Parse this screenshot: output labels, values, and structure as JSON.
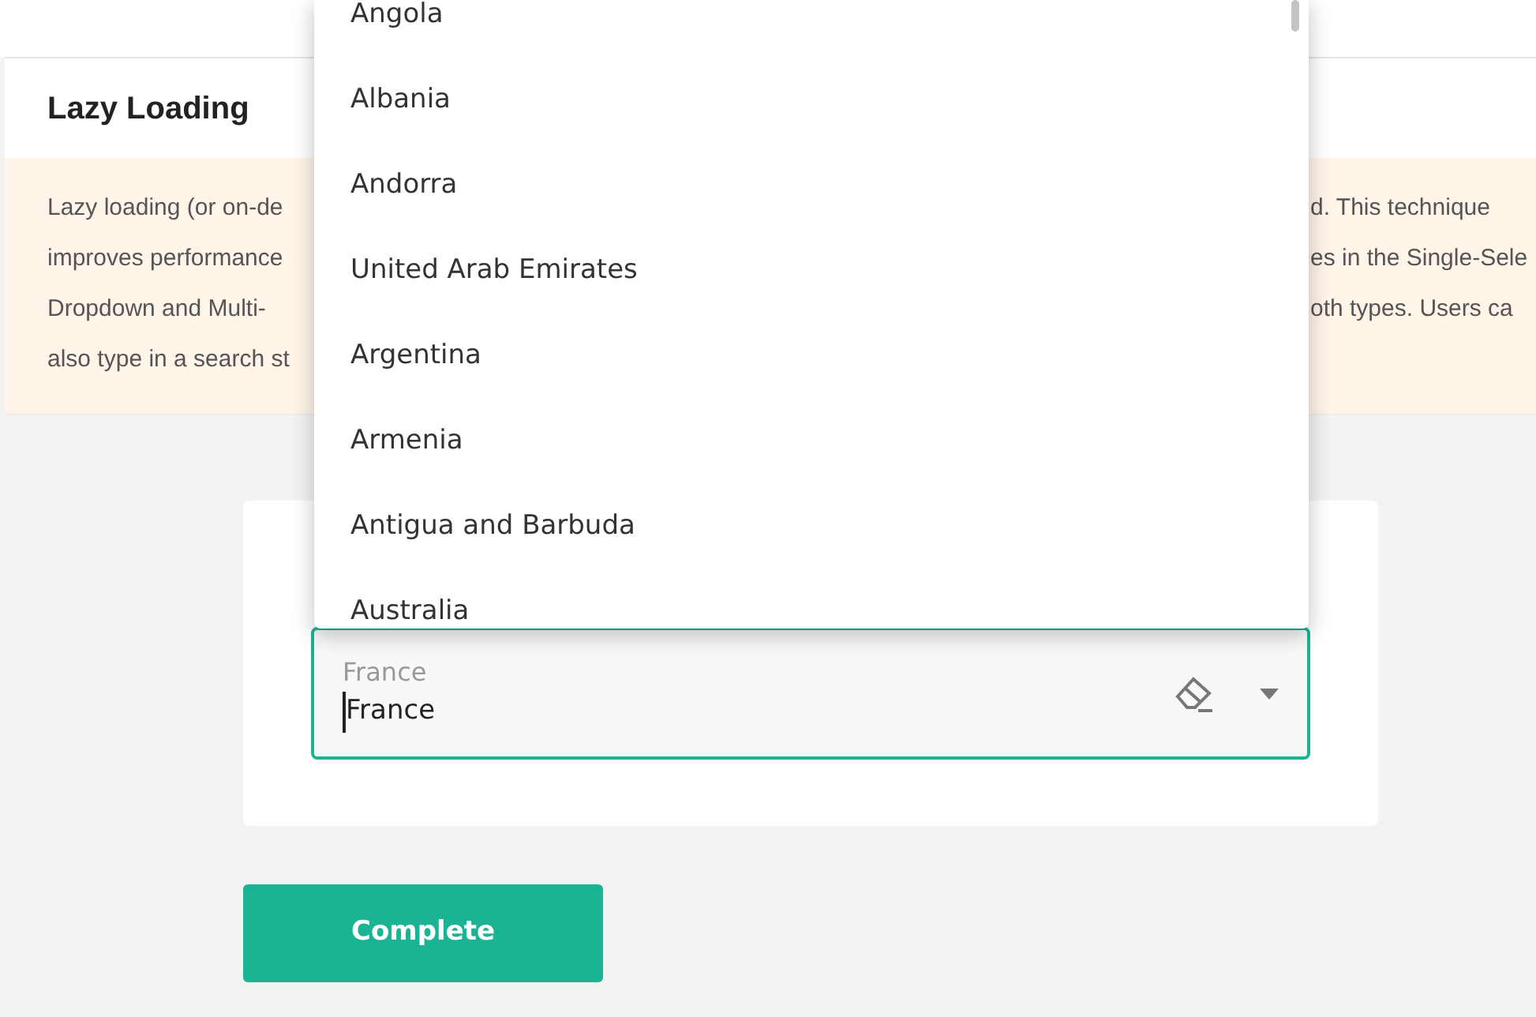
{
  "section": {
    "title": "Lazy Loading"
  },
  "description": {
    "lines": [
      {
        "left": "Lazy loading (or on-de",
        "right": "d. This technique"
      },
      {
        "left": "improves performance",
        "right": "es in the Single-Sele"
      },
      {
        "left": "Dropdown and Multi-",
        "right": "oth types. Users ca"
      },
      {
        "left": "also type in a search st"
      }
    ]
  },
  "dropdown": {
    "label": "France",
    "value": "France",
    "focused": true,
    "open": true,
    "options": [
      "Angola",
      "Albania",
      "Andorra",
      "United Arab Emirates",
      "Argentina",
      "Armenia",
      "Antigua and Barbuda",
      "Australia"
    ]
  },
  "button": {
    "label": "Complete"
  }
}
